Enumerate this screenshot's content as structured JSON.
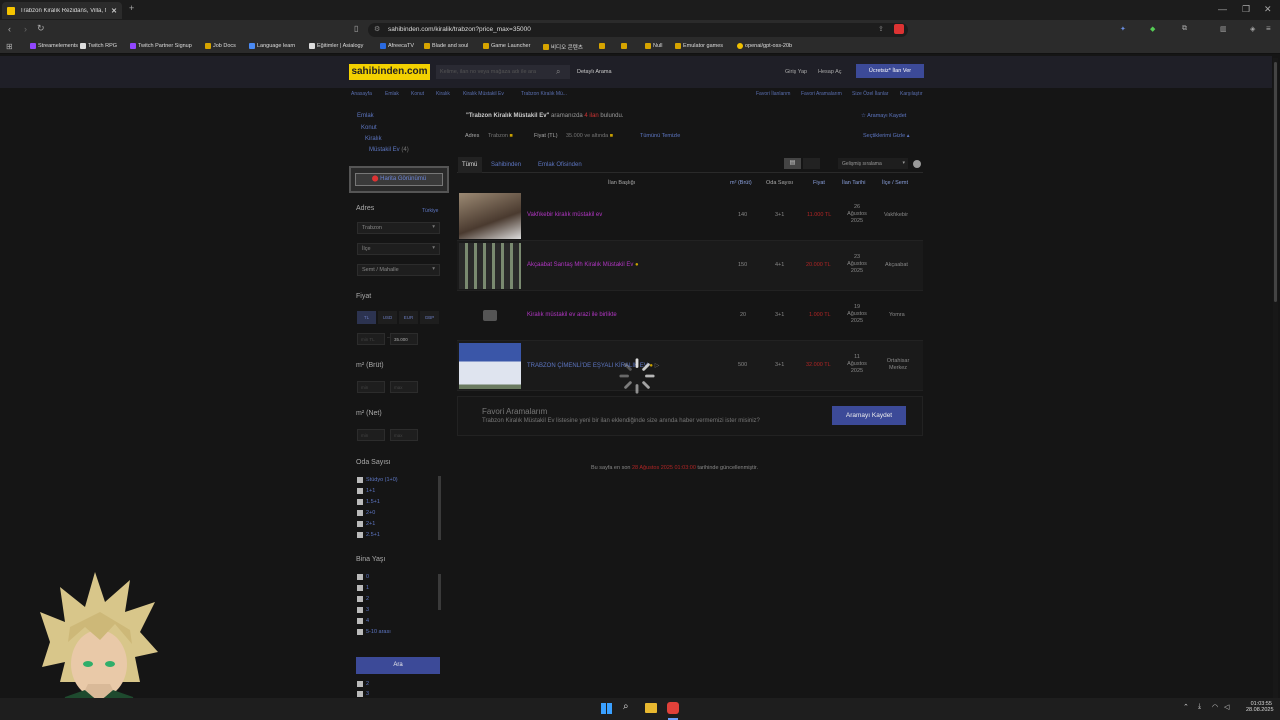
{
  "browser": {
    "tab_title": "Trabzon Kiralık Rezidans, Villa, M",
    "url": "sahibinden.com/kiralik/trabzon?price_max=35000",
    "bookmarks": [
      "Streamelements",
      "Twitch RPG",
      "Twitch Partner Signup",
      "Job Docs",
      "Language learn",
      "Eğitimler | Asialogy",
      "AfreecaTV",
      "Blade and soul",
      "Game Launcher",
      "비디오 콘텐츠",
      "",
      "",
      "Null",
      "Emulator games",
      "openai/gpt-oss-20b"
    ]
  },
  "header": {
    "logo": "sahibinden.com",
    "search_placeholder": "Kelime, ilan no veya mağaza adı ile ara",
    "detailed_search": "Detaylı Arama",
    "login": "Giriş Yap",
    "register": "Hesap Aç",
    "post_ad": "Ücretsiz* İlan Ver"
  },
  "breadcrumb": [
    "Anasayfa",
    "Emlak",
    "Konut",
    "Kiralık",
    "Kiralık Müstakil Ev",
    "Trabzon Kiralık Mü..."
  ],
  "top_links": [
    "Favori İlanlarım",
    "Favori Aramalarım",
    "Size Özel İlanlar",
    "Karşılaştır"
  ],
  "sidebar": {
    "categories": [
      "Emlak",
      "Konut",
      "Kiralık",
      "Müstakil Ev"
    ],
    "category_count": "(4)",
    "map_button": "Harita Görünümü",
    "address_label": "Adres",
    "address_link": "Türkiye",
    "city": "Trabzon",
    "district": "İlçe",
    "neighborhood": "Semt / Mahalle",
    "price_label": "Fiyat",
    "currencies": [
      "TL",
      "USD",
      "EUR",
      "GBP"
    ],
    "price_min_placeholder": "min TL",
    "price_max": "35.000",
    "gross_label": "m² (Brüt)",
    "net_label": "m² (Net)",
    "min_placeholder": "min",
    "max_placeholder": "max",
    "rooms_label": "Oda Sayısı",
    "rooms": [
      "Stüdyo (1+0)",
      "1+1",
      "1.5+1",
      "2+0",
      "2+1",
      "2.5+1"
    ],
    "building_age_label": "Bina Yaşı",
    "building_ages": [
      "0",
      "1",
      "2",
      "3",
      "4",
      "5-10 arası"
    ],
    "building_ages_tail": [
      "2",
      "3"
    ],
    "search_button": "Ara"
  },
  "results": {
    "summary_query": "\"Trabzon Kiralık Müstakil Ev\"",
    "summary_mid": " aramanızda ",
    "summary_count": "4 ilan",
    "summary_end": " bulundu.",
    "save_search": "Aramayı Kaydet",
    "filter_address_label": "Adres",
    "filter_address_value": "Trabzon",
    "filter_price_label": "Fiyat (TL)",
    "filter_price_value": "35.000 ve altında",
    "clear_all": "Tümünü Temizle",
    "hide_selections": "Seçtiklerimi Gizle",
    "tabs": [
      "Tümü",
      "Sahibinden",
      "Emlak Ofisinden"
    ],
    "sort": "Gelişmiş sıralama",
    "columns": [
      "İlan Başlığı",
      "m² (Brüt)",
      "Oda Sayısı",
      "Fiyat",
      "İlan Tarihi",
      "İlçe / Semt"
    ],
    "rows": [
      {
        "title": "Vakfıkebir kiralık müstakil ev",
        "m2": "140",
        "rooms": "3+1",
        "price": "11.000 TL",
        "date": [
          "26",
          "Ağustos",
          "2025"
        ],
        "location": "Vakfıkebir"
      },
      {
        "title": "Akçaabat Sarıtaş Mh Kiralık Müstakil Ev",
        "m2": "150",
        "rooms": "4+1",
        "price": "20.000 TL",
        "date": [
          "23",
          "Ağustos",
          "2025"
        ],
        "location": "Akçaabat"
      },
      {
        "title": "Kiralık müstakil ev arazi ile birlikte",
        "m2": "20",
        "rooms": "3+1",
        "price": "1.000 TL",
        "date": [
          "19",
          "Ağustos",
          "2025"
        ],
        "location": "Yomra"
      },
      {
        "title": "TRABZON ÇİMENLİ'DE EŞYALI KİRALIK EV",
        "m2": "500",
        "rooms": "3+1",
        "price": "32.000 TL",
        "date": [
          "11",
          "Ağustos",
          "2025"
        ],
        "location": [
          "Ortahisar",
          "Merkez"
        ]
      }
    ],
    "fav_title": "Favori Aramalarım",
    "fav_text": "Trabzon Kiralık Müstakil Ev listesine yeni bir ilan eklendiğinde size anında haber vermemizi ister misiniz?",
    "fav_button": "Aramayı Kaydet",
    "updated_prefix": "Bu sayfa en son ",
    "updated_date": "28 Ağustos 2025 01:03:00",
    "updated_suffix": " tarihinde güncellenmiştir."
  },
  "taskbar": {
    "time": "01:03:55",
    "date": "28.08.2025"
  },
  "colors": {
    "accent": "#3c4a98",
    "logo": "#f3d100",
    "link": "#b236c4",
    "price": "#b02525"
  }
}
